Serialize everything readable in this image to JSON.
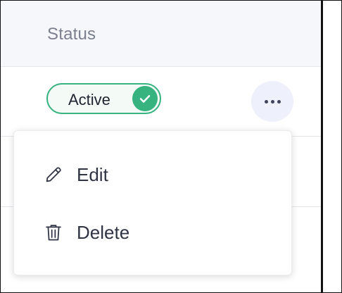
{
  "table": {
    "header": {
      "status_label": "Status"
    }
  },
  "row": {
    "status_badge": {
      "label": "Active",
      "color": "#36b37e"
    },
    "more_button_icon": "more-horizontal-icon"
  },
  "menu": {
    "items": [
      {
        "label": "Edit",
        "icon": "pencil-icon"
      },
      {
        "label": "Delete",
        "icon": "trash-icon"
      }
    ]
  }
}
